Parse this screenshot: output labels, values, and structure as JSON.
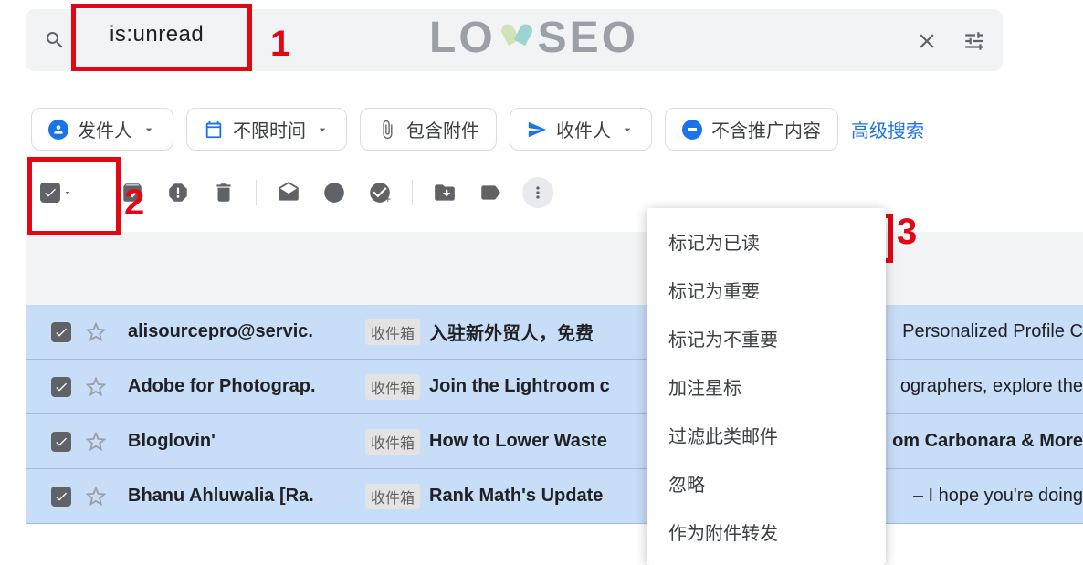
{
  "search": {
    "value": "is:unread"
  },
  "logo": {
    "left": "LO",
    "right": "SEO"
  },
  "chips": {
    "sender": "发件人",
    "time": "不限时间",
    "attach": "包含附件",
    "recipient": "收件人",
    "no_promo": "不含推广内容",
    "advanced": "高级搜索"
  },
  "menu": {
    "items": [
      "标记为已读",
      "标记为重要",
      "标记为不重要",
      "加注星标",
      "过滤此类邮件",
      "忽略",
      "作为附件转发"
    ]
  },
  "inbox_tag": "收件箱",
  "rows": [
    {
      "sender": "alisourcepro@servic.",
      "subject": "入驻新外贸人，免费",
      "tail": "Personalized Profile C"
    },
    {
      "sender": "Adobe for Photograp.",
      "subject": "Join the Lightroom c",
      "tail": "ographers, explore the"
    },
    {
      "sender": "Bloglovin'",
      "subject": "How to Lower Waste",
      "tail": "om Carbonara & More"
    },
    {
      "sender": "Bhanu Ahluwalia [Ra.",
      "subject": "Rank Math's Update",
      "tail": "– I hope you're doing"
    }
  ],
  "annotations": {
    "n1": "1",
    "n2": "2",
    "n3": "3"
  }
}
